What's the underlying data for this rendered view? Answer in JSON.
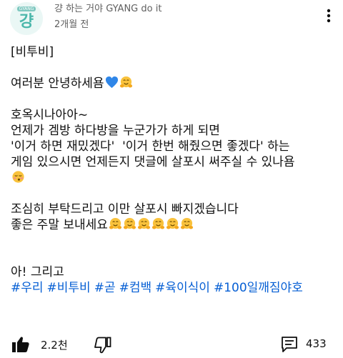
{
  "header": {
    "channel_name": "걍 하는 거야 GYANG do it",
    "time_ago": "2개월 전",
    "avatar_small_text": "GYANG",
    "avatar_big_text": "걍",
    "more_icon": "vertical-ellipsis-icon"
  },
  "post": {
    "lines": [
      "[비투비]",
      "",
      "여러분 안녕하세욤",
      "",
      "호옥시나아아~",
      "언제가 겜방 하다방을 누군가가 하게 되면",
      "'이거 하면 재밌겠다'  '이거 한번 해줬으면 좋겠다' 하는",
      "게임 있으시면 언제든지 댓글에 살포시 써주실 수 있나욤",
      "",
      "",
      "조심히 부탁드리고 이만 살포시 빠지겠습니다",
      "좋은 주말 보내세요",
      "",
      "",
      "아! 그리고"
    ],
    "hashtags": [
      "#우리",
      "#비투비",
      "#곧",
      "#컴백",
      "#육이식이",
      "#100일깨짐야호"
    ],
    "emojis": [
      "blue-heart-emoji",
      "hugging-face-emoji",
      "kissing-closed-eyes-emoji"
    ],
    "colors": {
      "hashtag": "#065fd4",
      "text": "#0f0f0f",
      "meta": "#606060"
    }
  },
  "actions": {
    "like_count": "2.2천",
    "comment_count": "433",
    "like_icon": "thumbs-up-filled-icon",
    "dislike_icon": "thumbs-down-outline-icon",
    "comment_icon": "comment-icon"
  }
}
